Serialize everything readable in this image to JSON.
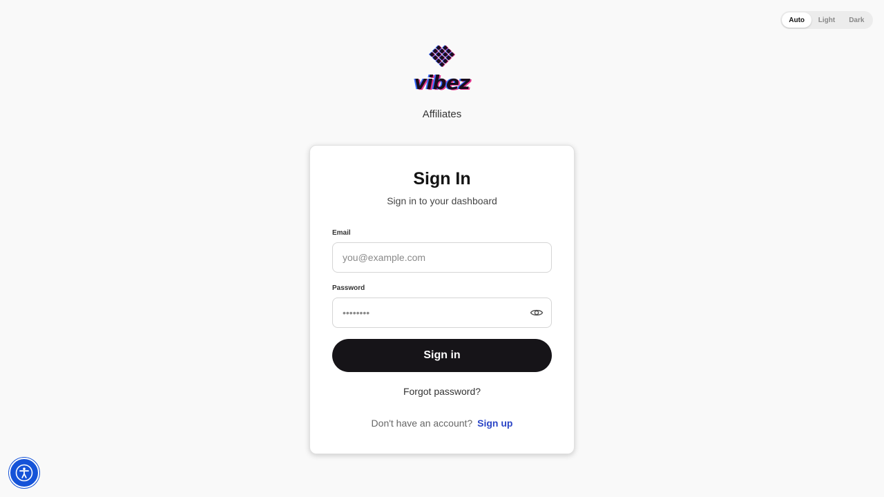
{
  "theme_toggle": {
    "options": [
      "Auto",
      "Light",
      "Dark"
    ],
    "selected": "Auto"
  },
  "brand": {
    "logo_text": "vibez",
    "subtitle": "Affiliates",
    "colors": {
      "pink": "#e6378f",
      "blue": "#3b6bff",
      "dark": "#1a0d1e"
    }
  },
  "signin": {
    "title": "Sign In",
    "subtitle": "Sign in to your dashboard",
    "email_label": "Email",
    "email_placeholder": "you@example.com",
    "password_label": "Password",
    "password_placeholder": "••••••••",
    "submit_label": "Sign in",
    "forgot_label": "Forgot password?",
    "no_account_text": "Don't have an account?",
    "signup_label": "Sign up"
  },
  "icons": {
    "password_toggle": "eye-icon",
    "accessibility": "accessibility-icon"
  },
  "colors": {
    "background": "#f9f9f9",
    "button": "#161418",
    "link": "#2b45c6",
    "accessibility": "#1553d8"
  }
}
